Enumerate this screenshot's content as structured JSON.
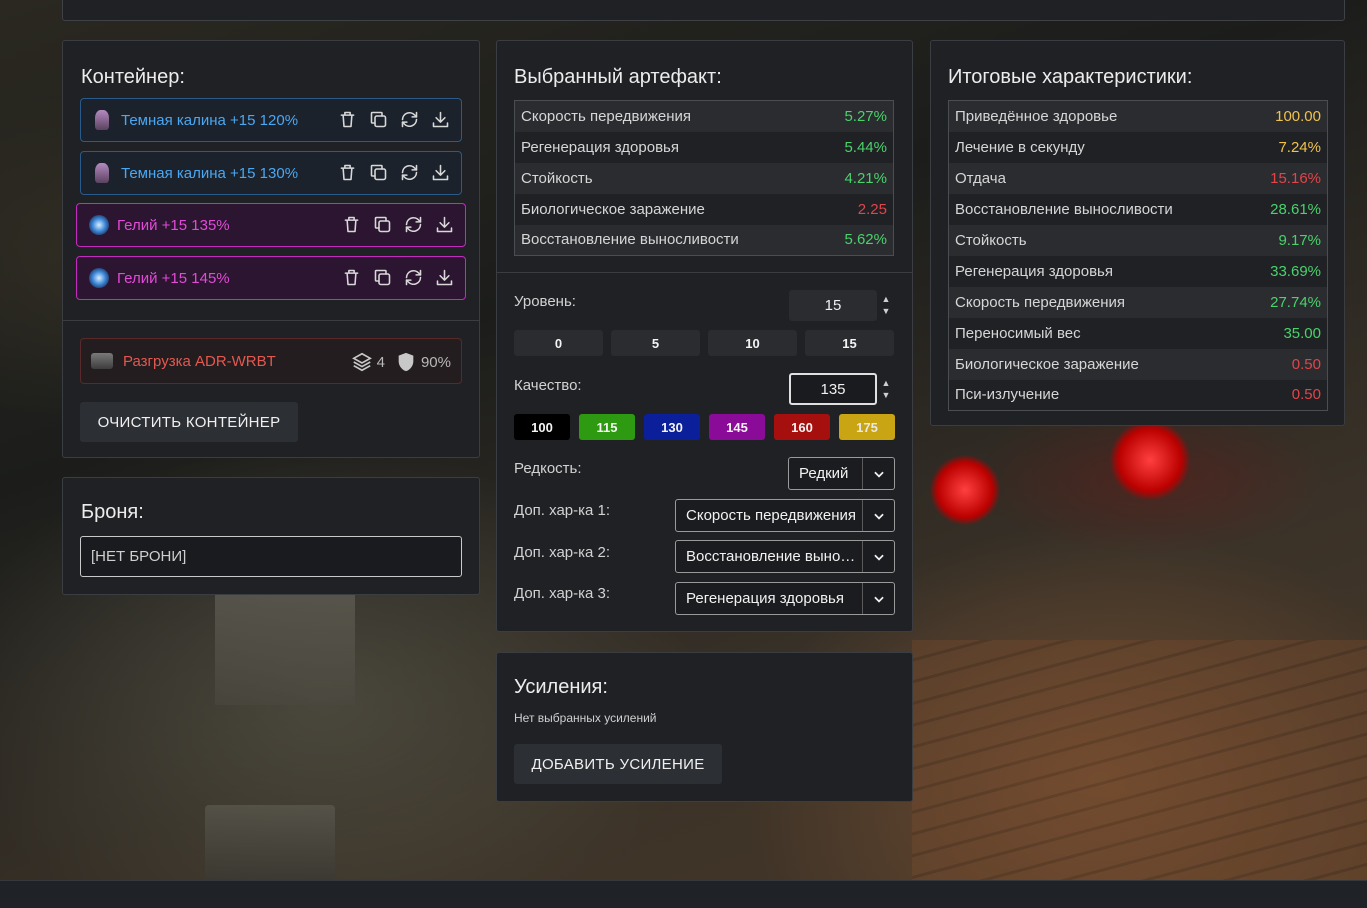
{
  "container": {
    "title": "Контейнер:",
    "items": [
      {
        "name": "Темная калина +15 120%",
        "style": "blue",
        "icon": "kalina-icon"
      },
      {
        "name": "Темная калина +15 130%",
        "style": "blue",
        "icon": "kalina-icon"
      },
      {
        "name": "Гелий +15 135%",
        "style": "purple",
        "icon": "gelium-icon"
      },
      {
        "name": "Гелий +15 145%",
        "style": "purple",
        "icon": "gelium-icon"
      }
    ],
    "vest": {
      "name": "Разгрузка ADR-WRBT",
      "slots": "4",
      "protection": "90%"
    },
    "clear_button": "ОЧИСТИТЬ КОНТЕЙНЕР"
  },
  "armor": {
    "title": "Броня:",
    "value": "[НЕТ БРОНИ]"
  },
  "artifact": {
    "title": "Выбранный артефакт:",
    "stats": [
      {
        "name": "Скорость передвижения",
        "value": "5.27%",
        "color": "green"
      },
      {
        "name": "Регенерация здоровья",
        "value": "5.44%",
        "color": "green"
      },
      {
        "name": "Стойкость",
        "value": "4.21%",
        "color": "green"
      },
      {
        "name": "Биологическое заражение",
        "value": "2.25",
        "color": "red"
      },
      {
        "name": "Восстановление выносливости",
        "value": "5.62%",
        "color": "green"
      }
    ],
    "level_label": "Уровень:",
    "level_value": "15",
    "level_presets": [
      "0",
      "5",
      "10",
      "15"
    ],
    "quality_label": "Качество:",
    "quality_value": "135",
    "quality_presets": [
      {
        "label": "100",
        "color": "#000000"
      },
      {
        "label": "115",
        "color": "#2e9a12"
      },
      {
        "label": "130",
        "color": "#0c1f9a"
      },
      {
        "label": "145",
        "color": "#8a0b97"
      },
      {
        "label": "160",
        "color": "#a5100f"
      },
      {
        "label": "175",
        "color": "#c9a413"
      }
    ],
    "rarity_label": "Редкость:",
    "rarity_value": "Редкий",
    "extra1_label": "Доп. хар-ка 1:",
    "extra1_value": "Скорость передвижения",
    "extra2_label": "Доп. хар-ка 2:",
    "extra2_value": "Восстановление выносливости",
    "extra3_label": "Доп. хар-ка 3:",
    "extra3_value": "Регенерация здоровья"
  },
  "upgrades": {
    "title": "Усиления:",
    "empty_text": "Нет выбранных усилений",
    "add_button": "ДОБАВИТЬ УСИЛЕНИЕ"
  },
  "totals": {
    "title": "Итоговые характеристики:",
    "stats": [
      {
        "name": "Приведённое здоровье",
        "value": "100.00",
        "color": "yellow"
      },
      {
        "name": "Лечение в секунду",
        "value": "7.24%",
        "color": "yellow"
      },
      {
        "name": "Отдача",
        "value": "15.16%",
        "color": "red"
      },
      {
        "name": "Восстановление выносливости",
        "value": "28.61%",
        "color": "green"
      },
      {
        "name": "Стойкость",
        "value": "9.17%",
        "color": "green"
      },
      {
        "name": "Регенерация здоровья",
        "value": "33.69%",
        "color": "green"
      },
      {
        "name": "Скорость передвижения",
        "value": "27.74%",
        "color": "green"
      },
      {
        "name": "Переносимый вес",
        "value": "35.00",
        "color": "green"
      },
      {
        "name": "Биологическое заражение",
        "value": "0.50",
        "color": "red"
      },
      {
        "name": "Пси-излучение",
        "value": "0.50",
        "color": "red"
      }
    ]
  }
}
